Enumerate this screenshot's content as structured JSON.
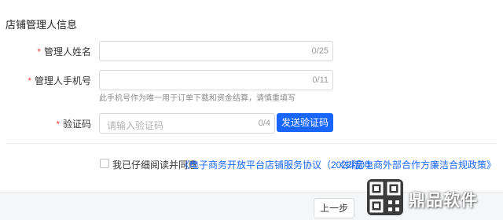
{
  "section": {
    "title": "店铺管理人信息"
  },
  "form": {
    "name": {
      "required_mark": "*",
      "label": "管理人姓名",
      "counter": "0/25",
      "value": ""
    },
    "phone": {
      "required_mark": "*",
      "label": "管理人手机号",
      "counter": "0/11",
      "value": "",
      "hint": "此手机号作为唯一用于订单下载和资金结算，请慎重填写"
    },
    "code": {
      "required_mark": "*",
      "label": "验证码",
      "placeholder": "请输入验证码",
      "counter": "0/4",
      "send_label": "发送验证码"
    }
  },
  "agreement": {
    "checked": false,
    "prefix": "我已仔细阅读并同意",
    "link1": "《电子商务开放平台店铺服务协议（2022版）》",
    "link2": "《抖音电商外部合作方廉洁合规政策》"
  },
  "footer": {
    "prev_label": "上一步"
  },
  "watermark": {
    "text": "鼎品软件"
  },
  "colors": {
    "primary": "#1966ff",
    "required": "#f5483b"
  }
}
